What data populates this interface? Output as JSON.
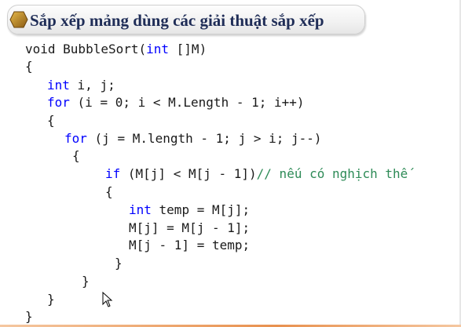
{
  "slide": {
    "title": "Sắp xếp mảng dùng các giải thuật sắp xếp",
    "title_icon": "hexagon-bullet-icon",
    "colors": {
      "title_text": "#1f2d57",
      "keyword": "#0000ff",
      "comment": "#2e8b57",
      "code_text": "#1a1a1a",
      "icon_fill": "#b8860b"
    }
  },
  "code": {
    "lines": [
      {
        "id": "l1",
        "segments": [
          {
            "t": "void BubbleSort(",
            "c": "plain"
          },
          {
            "t": "int",
            "c": "kw"
          },
          {
            "t": " []M)",
            "c": "plain"
          }
        ]
      },
      {
        "id": "l2",
        "segments": [
          {
            "t": "{",
            "c": "plain"
          }
        ]
      },
      {
        "id": "l3",
        "segments": [
          {
            "t": "int",
            "c": "kw"
          },
          {
            "t": " i, j;",
            "c": "plain"
          }
        ]
      },
      {
        "id": "l4",
        "segments": [
          {
            "t": "for",
            "c": "kw"
          },
          {
            "t": " (i = 0; i < M.Length - 1; i++)",
            "c": "plain"
          }
        ]
      },
      {
        "id": "l5",
        "segments": [
          {
            "t": "{",
            "c": "plain"
          }
        ]
      },
      {
        "id": "l6",
        "segments": [
          {
            "t": "for",
            "c": "kw"
          },
          {
            "t": " (j = M.length - 1; j > i; j--)",
            "c": "plain"
          }
        ]
      },
      {
        "id": "l7",
        "segments": [
          {
            "t": "{",
            "c": "plain"
          }
        ]
      },
      {
        "id": "l8",
        "segments": [
          {
            "t": "if",
            "c": "kw"
          },
          {
            "t": " (M[j] < M[j - 1])",
            "c": "plain"
          },
          {
            "t": "// nếu có nghịch thế",
            "c": "comment"
          }
        ]
      },
      {
        "id": "l9",
        "segments": [
          {
            "t": "{",
            "c": "plain"
          }
        ]
      },
      {
        "id": "l10",
        "segments": [
          {
            "t": "int",
            "c": "kw"
          },
          {
            "t": " temp = M[j];",
            "c": "plain"
          }
        ]
      },
      {
        "id": "l11",
        "segments": [
          {
            "t": "M[j] = M[j - 1];",
            "c": "plain"
          }
        ]
      },
      {
        "id": "l12",
        "segments": [
          {
            "t": "M[j - 1] = temp;",
            "c": "plain"
          }
        ]
      },
      {
        "id": "l13",
        "segments": [
          {
            "t": "}",
            "c": "plain"
          }
        ]
      },
      {
        "id": "l14",
        "segments": [
          {
            "t": "}",
            "c": "plain"
          }
        ]
      },
      {
        "id": "l15",
        "segments": [
          {
            "t": "}",
            "c": "plain"
          }
        ]
      },
      {
        "id": "l16",
        "segments": [
          {
            "t": "}",
            "c": "plain"
          }
        ]
      }
    ]
  },
  "cursor_icon": "mouse-pointer-icon"
}
